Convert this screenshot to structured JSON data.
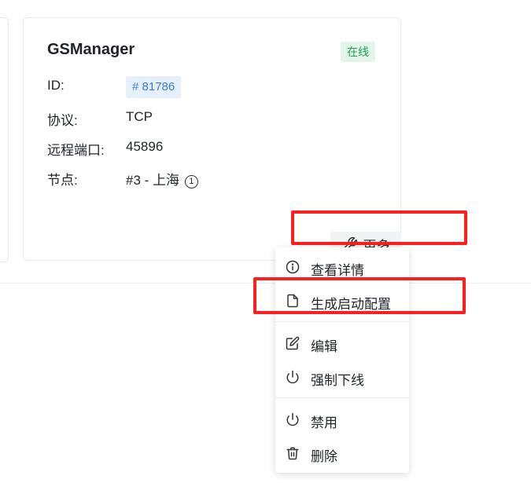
{
  "card": {
    "title": "GSManager",
    "status": "在线",
    "fields": {
      "id_label": "ID:",
      "id_value": "# 81786",
      "protocol_label": "协议:",
      "protocol_value": "TCP",
      "port_label": "远程端口:",
      "port_value": "45896",
      "node_label": "节点:",
      "node_value": "#3 - 上海",
      "node_info_icon": "info-circle-icon"
    },
    "more_button": {
      "label": "更多",
      "icon": "wrench-icon"
    }
  },
  "dropdown": {
    "groups": [
      [
        {
          "label": "查看详情",
          "icon": "info-circle-icon"
        },
        {
          "label": "生成启动配置",
          "icon": "file-icon"
        }
      ],
      [
        {
          "label": "编辑",
          "icon": "edit-icon"
        },
        {
          "label": "强制下线",
          "icon": "power-icon"
        }
      ],
      [
        {
          "label": "禁用",
          "icon": "power-icon"
        },
        {
          "label": "删除",
          "icon": "trash-icon"
        }
      ]
    ]
  },
  "colors": {
    "highlight": "#ff1e1e",
    "status_green": "#1e9e52",
    "id_blue": "#3b7ddd"
  }
}
